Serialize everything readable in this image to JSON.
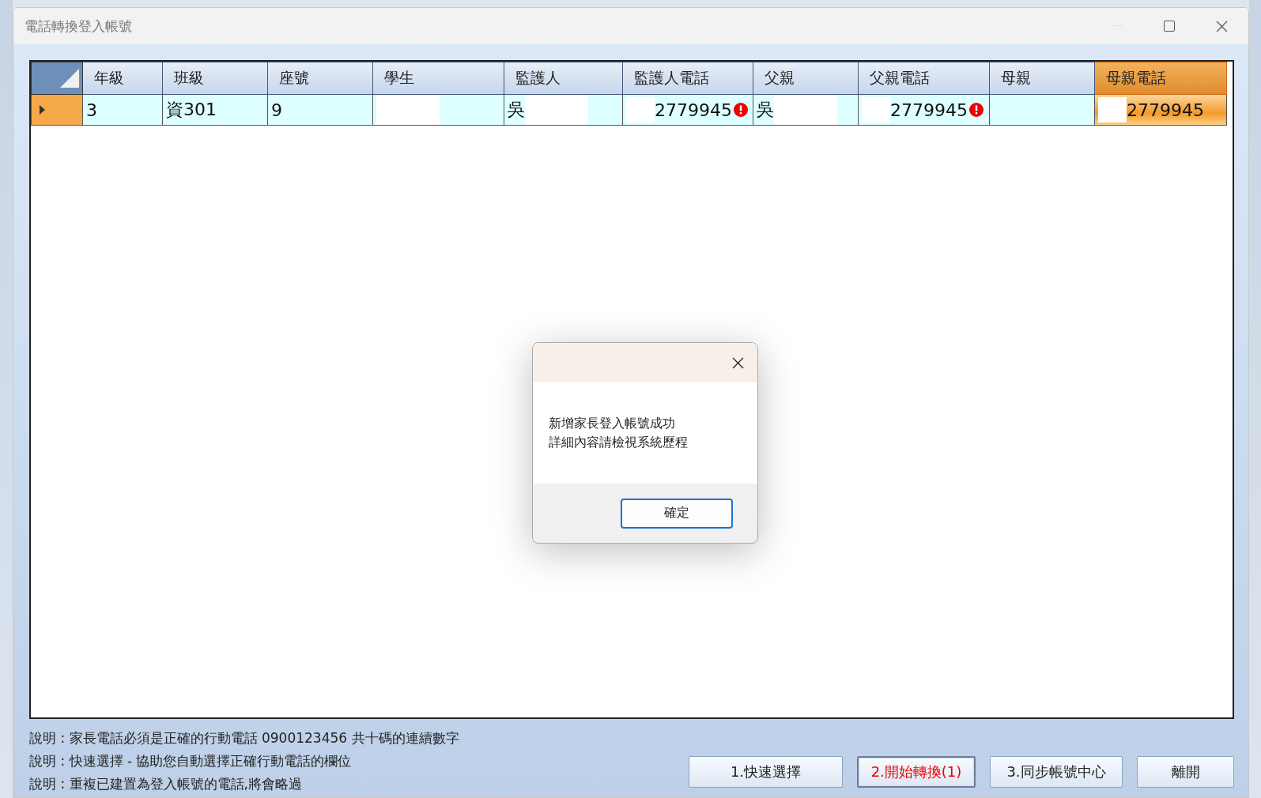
{
  "window": {
    "title": "電話轉換登入帳號"
  },
  "table": {
    "columns": [
      {
        "label": "年級",
        "selected": false
      },
      {
        "label": "班級",
        "selected": false
      },
      {
        "label": "座號",
        "selected": false
      },
      {
        "label": "學生",
        "selected": false
      },
      {
        "label": "監護人",
        "selected": false
      },
      {
        "label": "監護人電話",
        "selected": false
      },
      {
        "label": "父親",
        "selected": false
      },
      {
        "label": "父親電話",
        "selected": false
      },
      {
        "label": "母親",
        "selected": false
      },
      {
        "label": "母親電話",
        "selected": true
      }
    ],
    "rows": [
      {
        "selected": true,
        "cells": [
          {
            "text": "3",
            "selected": false
          },
          {
            "text": "資301",
            "selected": false
          },
          {
            "text": "9",
            "selected": false
          },
          {
            "masked": true,
            "selected": false
          },
          {
            "text": "吳",
            "masked": true,
            "selected": false
          },
          {
            "text": "2779945",
            "masked": true,
            "error": true,
            "selected": false
          },
          {
            "text": "吳",
            "masked": true,
            "selected": false
          },
          {
            "text": "2779945",
            "masked": true,
            "error": true,
            "selected": false
          },
          {
            "selected": false
          },
          {
            "text": "2779945",
            "masked": true,
            "selected": true
          }
        ]
      }
    ]
  },
  "notes": [
    "說明 : 家長電話必須是正確的行動電話 0900123456 共十碼的連續數字",
    "說明 : 快速選擇 - 協助您自動選擇正確行動電話的欄位",
    "說明 : 重複已建置為登入帳號的電話,將會略過"
  ],
  "buttons": [
    {
      "label": "1.快速選擇",
      "highlight": false
    },
    {
      "label": "2.開始轉換(1)",
      "highlight": true
    },
    {
      "label": "3.同步帳號中心",
      "highlight": false
    },
    {
      "label": "離開",
      "highlight": false
    }
  ],
  "dialog": {
    "message": [
      "新增家長登入帳號成功",
      "詳細內容請檢視系統歷程"
    ],
    "button": "確定"
  }
}
